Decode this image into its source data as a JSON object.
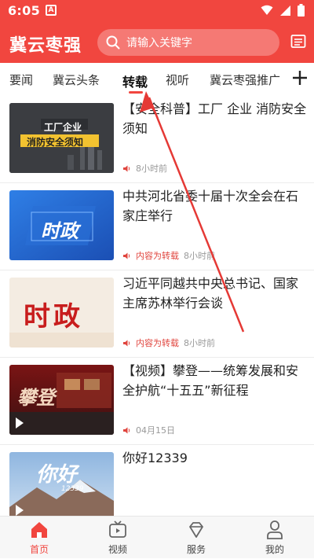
{
  "status_bar": {
    "time": "6:05"
  },
  "header": {
    "title": "冀云枣强",
    "search_placeholder": "请输入关键字",
    "accent_color": "#f1463f"
  },
  "tabs": [
    {
      "label": "要闻"
    },
    {
      "label": "冀云头条"
    },
    {
      "label": "转载",
      "active": true
    },
    {
      "label": "视听"
    },
    {
      "label": "冀云枣强推广"
    }
  ],
  "feed": [
    {
      "title": "【安全科普】工厂 企业 消防安全须知",
      "thumb_caption_1": "工厂企业",
      "thumb_caption_2": "消防安全须知",
      "repost_label": "",
      "time": "8小时前"
    },
    {
      "title": "中共河北省委十届十次全会在石家庄举行",
      "thumb_caption_1": "时政",
      "repost_label": "内容为转载",
      "time": "8小时前"
    },
    {
      "title": "习近平同越共中央总书记、国家主席苏林举行会谈",
      "thumb_caption_1": "时政",
      "repost_label": "内容为转载",
      "time": "8小时前"
    },
    {
      "title": "【视频】攀登——统筹发展和安全护航“十五五”新征程",
      "thumb_caption_1": "攀登",
      "repost_label": "",
      "time": "04月15日"
    },
    {
      "title": "你好12339",
      "thumb_caption_1": "你好",
      "thumb_caption_2": "12339",
      "repost_label": "",
      "time": ""
    }
  ],
  "bottom_nav": [
    {
      "label": "首页",
      "icon": "home-icon",
      "active": true
    },
    {
      "label": "视频",
      "icon": "tv-icon"
    },
    {
      "label": "服务",
      "icon": "diamond-icon"
    },
    {
      "label": "我的",
      "icon": "user-icon"
    }
  ]
}
